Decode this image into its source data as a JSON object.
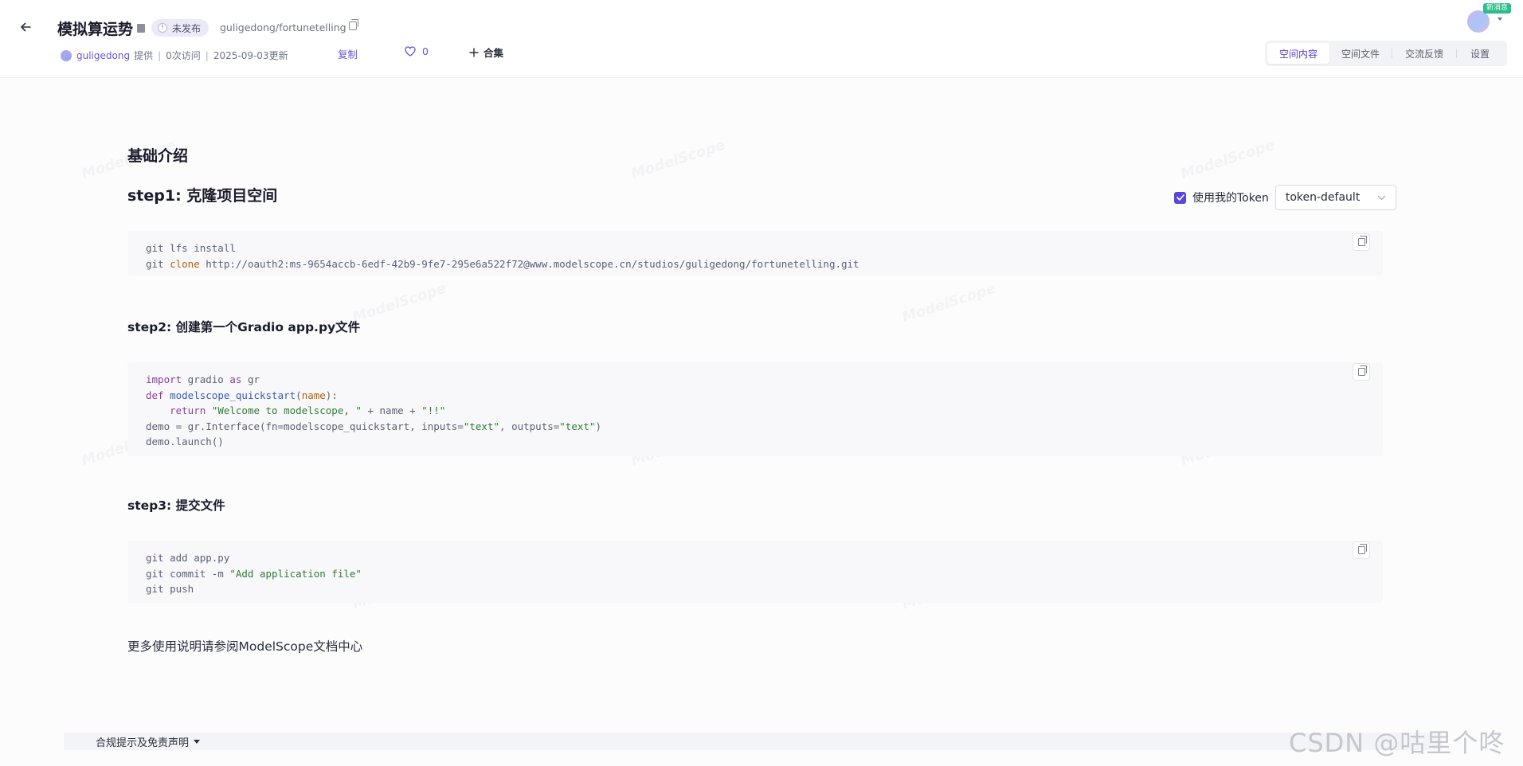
{
  "header": {
    "title": "模拟算运势",
    "status_badge": "未发布",
    "repo_path": "guligedong/fortunetelling",
    "author": "guligedong",
    "provided": "提供",
    "visits": "0次访问",
    "updated": "2025-09-03更新",
    "copy_label": "复制",
    "like_count": "0",
    "collection_label": "合集",
    "new_message_badge": "新消息"
  },
  "tabs": [
    {
      "label": "空间内容",
      "active": true
    },
    {
      "label": "空间文件",
      "active": false
    },
    {
      "label": "交流反馈",
      "active": false
    },
    {
      "label": "设置",
      "active": false
    }
  ],
  "content": {
    "intro_heading": "基础介绍",
    "step1_heading": "step1: 克隆项目空间",
    "token_checkbox_label": "使用我的Token",
    "token_select_value": "token-default",
    "step1_code": {
      "line1": "git lfs install",
      "line2_cmd": "git ",
      "line2_kw": "clone",
      "line2_rest": " http://oauth2:ms-9654accb-6edf-42b9-9fe7-295e6a522f72@www.modelscope.cn/studios/guligedong/fortunetelling.git"
    },
    "step2_heading": "step2: 创建第一个Gradio app.py文件",
    "step2_code": {
      "l1_kw": "import",
      "l1_rest": " gradio ",
      "l1_kw2": "as",
      "l1_rest2": " gr",
      "l2_kw": "def",
      "l2_fn": "modelscope_quickstart",
      "l2_open": "(",
      "l2_param": "name",
      "l2_close": "):",
      "l3_indent": "    ",
      "l3_kw": "return",
      "l3_sp": " ",
      "l3_str1": "\"Welcome to modelscope, \"",
      "l3_mid": " + name + ",
      "l3_str2": "\"!!\"",
      "l4_pre": "demo = gr.Interface(fn=modelscope_quickstart, inputs=",
      "l4_str1": "\"text\"",
      "l4_mid": ", outputs=",
      "l4_str2": "\"text\"",
      "l4_end": ")",
      "l5": "demo.launch()"
    },
    "step3_heading": "step3: 提交文件",
    "step3_code": {
      "line1": "git add app.py",
      "line2_pre": "git commit -m ",
      "line2_str": "\"Add application file\"",
      "line3": "git push"
    },
    "more_docs": "更多使用说明请参阅ModelScope文档中心"
  },
  "footer": {
    "disclaimer": "合规提示及免责声明",
    "csdn_watermark": "CSDN @咕里个咚"
  },
  "watermark_text": "ModelScope",
  "colors": {
    "accent": "#5b45d8",
    "link": "#6b52d9",
    "badge_green": "#2dbd8a"
  }
}
